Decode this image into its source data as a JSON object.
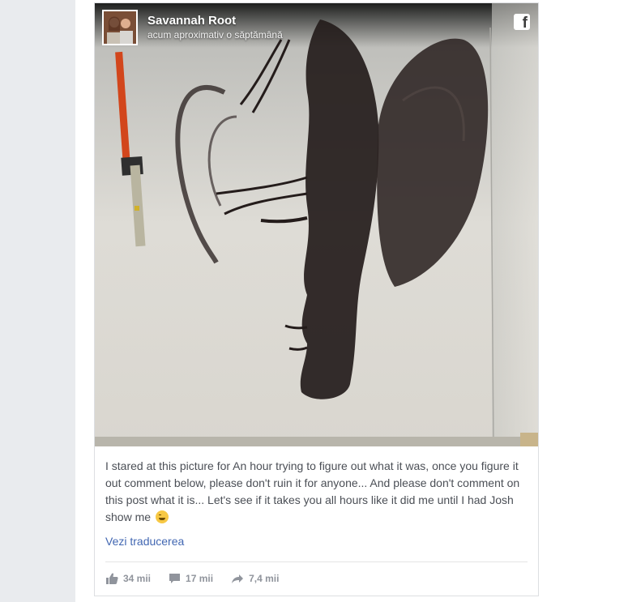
{
  "post": {
    "author": "Savannah Root",
    "time": "acum aproximativ o săptămână",
    "caption": "I stared at this picture for An hour trying to figure out what it was, once you figure it out comment below, please don't ruin it for anyone... And please don't comment on this post what it is... Let's see if it takes you all hours like it did me until I had Josh show me",
    "caption_emoji": "grinning-sweat-emoji",
    "translate_label": "Vezi traducerea",
    "source_icon": "facebook-icon"
  },
  "stats": {
    "likes": "34 mii",
    "comments": "17 mii",
    "shares": "7,4 mii"
  },
  "icons": {
    "like": "thumbs-up-icon",
    "comment": "speech-bubble-icon",
    "share": "share-arrow-icon"
  },
  "colors": {
    "link": "#4267b2",
    "stats_text": "#90949c",
    "caption_text": "#4b4f56",
    "page_gutter": "#e9ebee"
  }
}
